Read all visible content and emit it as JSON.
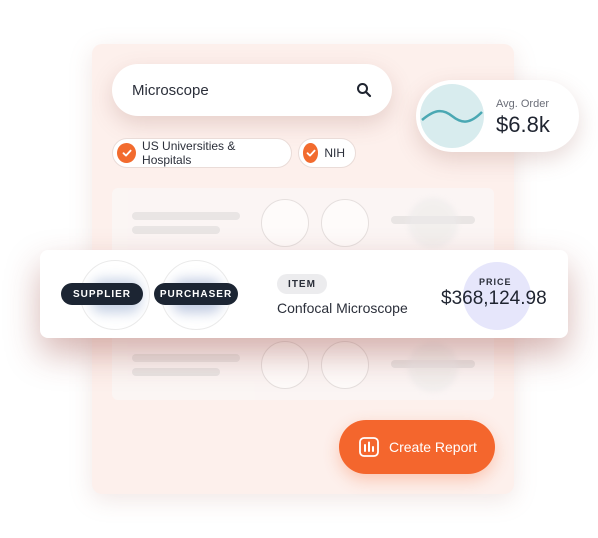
{
  "search": {
    "value": "Microscope"
  },
  "avg_order": {
    "label": "Avg. Order",
    "value": "$6.8k"
  },
  "filters": [
    {
      "label": "US Universities & Hospitals",
      "checked": true
    },
    {
      "label": "NIH",
      "checked": true
    }
  ],
  "result": {
    "supplier_label": "SUPPLIER",
    "purchaser_label": "PURCHASER",
    "item_label": "ITEM",
    "item_name": "Confocal Microscope",
    "price_label": "PRICE",
    "price_value": "$368,124.98"
  },
  "actions": {
    "create_report": "Create Report"
  },
  "colors": {
    "accent": "#f4662d",
    "dark_pill": "#1c2533",
    "panel": "#fdf0ec",
    "price_bg": "#e6e6fb",
    "chart_line": "#4aa8b3"
  }
}
